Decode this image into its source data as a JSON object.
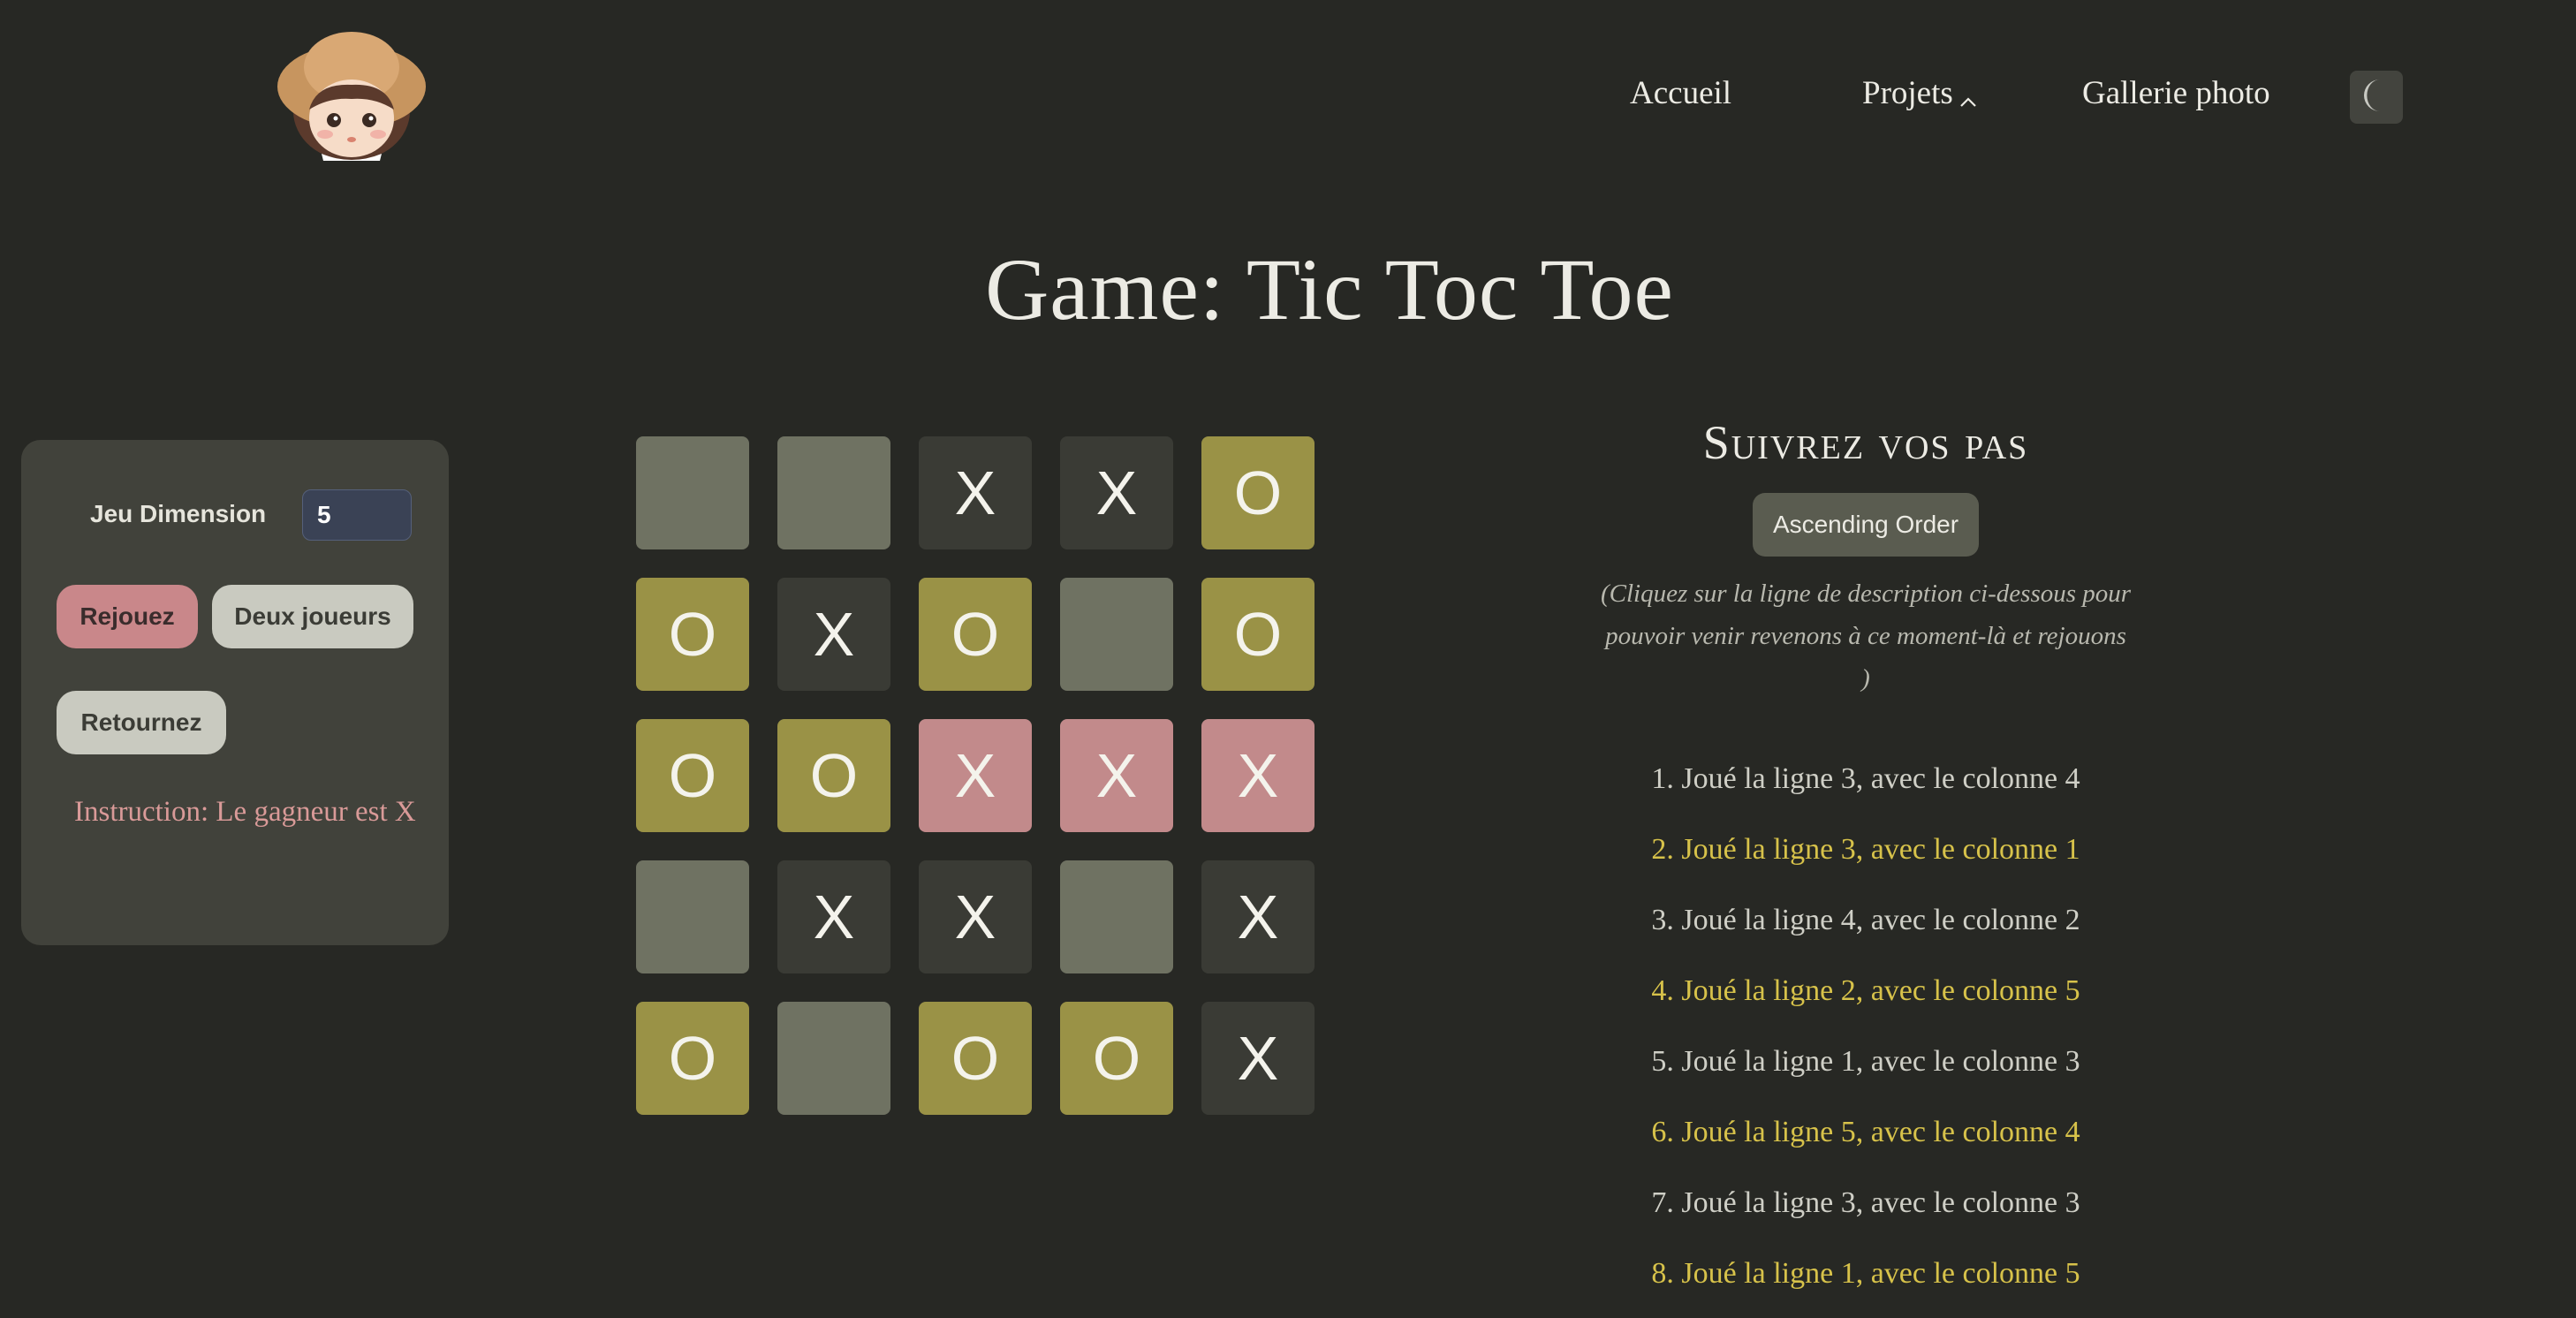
{
  "nav": {
    "avatar_alt": "avatar",
    "items": [
      "Accueil",
      "Projets",
      "Gallerie photo"
    ],
    "theme_icon": "moon-icon"
  },
  "title": "Game: Tic Toc Toe",
  "controls": {
    "dimension_label": "Jeu Dimension",
    "dimension_value": "5",
    "replay_label": "Rejouez",
    "two_players_label": "Deux joueurs",
    "back_label": "Retournez",
    "instruction": "Instruction: Le gagneur est X"
  },
  "board": {
    "size": 5,
    "cells": [
      [
        "",
        "",
        "X",
        "X",
        "O"
      ],
      [
        "O",
        "X",
        "O",
        "",
        "O"
      ],
      [
        "O",
        "O",
        "X",
        "X",
        "X"
      ],
      [
        "",
        "X",
        "X",
        "",
        "X"
      ],
      [
        "O",
        "",
        "O",
        "O",
        "X"
      ]
    ],
    "winning_row": 3,
    "winning_cols": [
      3,
      4,
      5
    ]
  },
  "history": {
    "heading": "Suivrez vos pas",
    "order_label": "Ascending Order",
    "note": "(Cliquez sur la ligne de description ci-dessous pour pouvoir venir revenons à ce moment-là et rejouons )",
    "moves": [
      "1. Joué la ligne 3, avec le colonne 4",
      "2. Joué la ligne 3, avec le colonne 1",
      "3. Joué la ligne 4, avec le colonne 2",
      "4. Joué la ligne 2, avec le colonne 5",
      "5. Joué la ligne 1, avec le colonne 3",
      "6. Joué la ligne 5, avec le colonne 4",
      "7. Joué la ligne 3, avec le colonne 3",
      "8. Joué la ligne 1, avec le colonne 5"
    ]
  },
  "colors": {
    "background": "#272824",
    "cell_empty": "#6f7262",
    "cell_x": "#3a3b35",
    "cell_o": "#9a9246",
    "cell_win": "#c28a8b",
    "move_highlight": "#d7c24a"
  }
}
